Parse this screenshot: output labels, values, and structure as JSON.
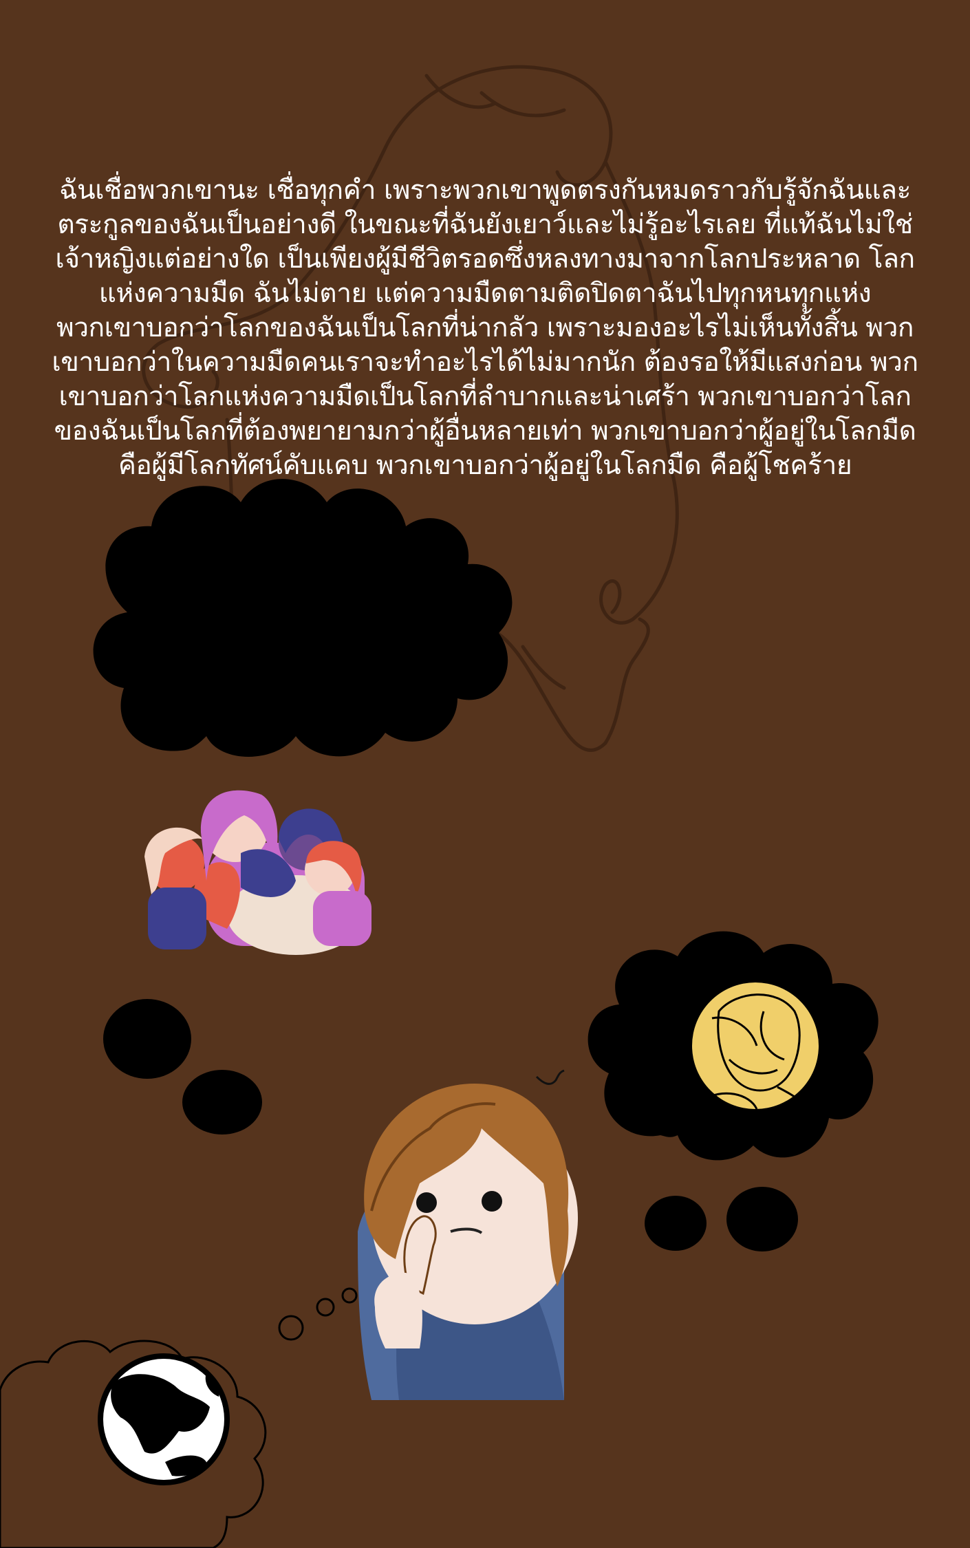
{
  "story": {
    "paragraph_1": "ฉันเชื่อพวกเขานะ เชื่อทุกคำ เพราะพวกเขาพูดตรงกันหมดราวกับรู้จักฉันและตระกูลของฉันเป็นอย่างดี ในขณะที่ฉันยังเยาว์และไม่รู้อะไรเลย ที่แท้ฉันไม่ใช่เจ้าหญิงแต่อย่างใด เป็นเพียงผู้มีชีวิตรอดซึ่งหลงทางมาจากโลกประหลาด โลกแห่งความมืด ฉันไม่ตาย แต่ความมืดตามติดปิดตาฉันไปทุกหนทุกแห่ง",
    "paragraph_2": "พวกเขาบอกว่าโลกของฉันเป็นโลกที่น่ากลัว เพราะมองอะไรไม่เห็นทั้งสิ้น พวกเขาบอกว่าในความมืดคนเราจะทำอะไรได้ไม่มากนัก ต้องรอให้มีแสงก่อน พวกเขาบอกว่าโลกแห่งความมืดเป็นโลกที่ลำบากและน่าเศร้า พวกเขาบอกว่าโลกของฉันเป็นโลกที่ต้องพยายามกว่าผู้อื่นหลายเท่า พวกเขาบอกว่าผู้อยู่ในโลกมืด คือผู้มีโลกทัศน์คับแคบ พวกเขาบอกว่าผู้อยู่ในโลกมืด คือผู้โชคร้าย"
  },
  "colors": {
    "background": "#56341d",
    "text": "#ffffff",
    "thought_bubble": "#000000",
    "ghost_outline": "#3f2413",
    "moon": "#f0cf6a"
  },
  "illustrations": {
    "ghost": "ghost-sketch",
    "group_bubble": "group-of-girls-illustration",
    "covering_face_bubble": "person-covering-face-illustration",
    "thinking_girl": "thinking-girl-illustration",
    "globe_bubble": "globe-icon"
  }
}
